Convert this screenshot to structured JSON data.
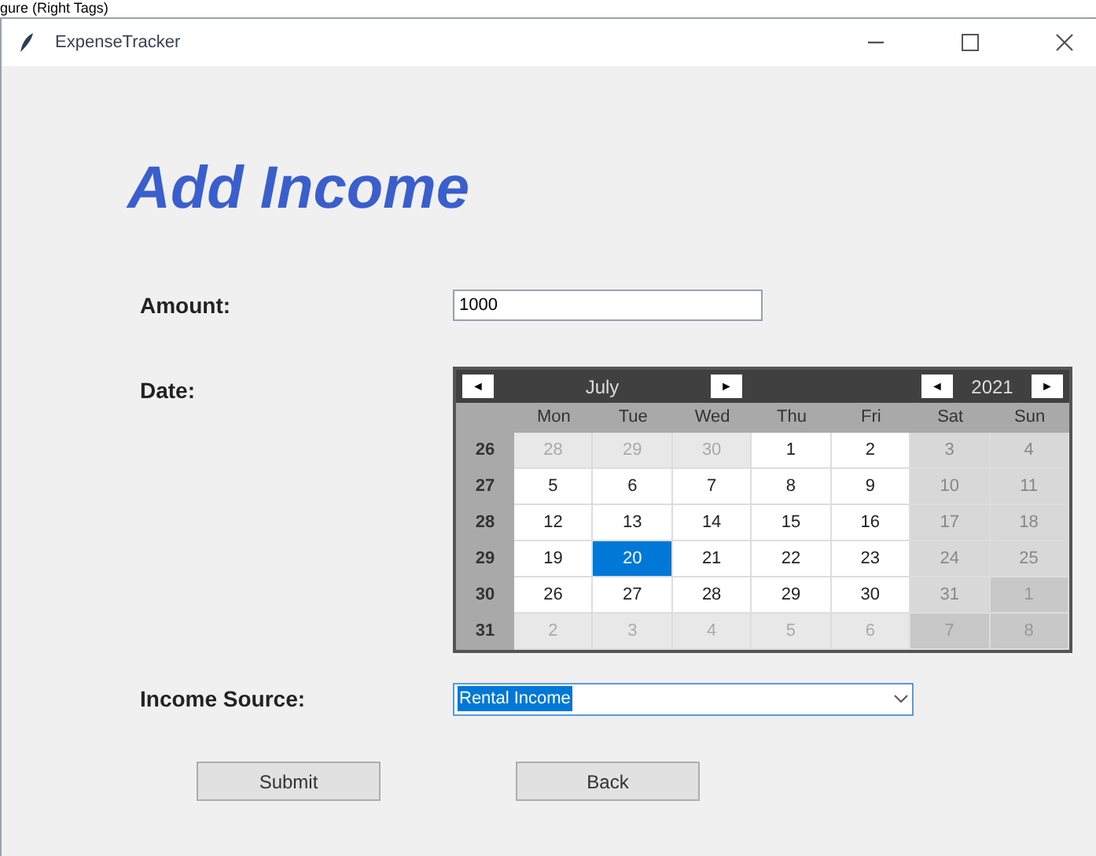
{
  "page_fragment": "gure (Right Tags)",
  "window": {
    "title": "ExpenseTracker"
  },
  "heading": "Add Income",
  "amount": {
    "label": "Amount:",
    "value": "1000"
  },
  "date": {
    "label": "Date:",
    "calendar": {
      "prev_month": "◄",
      "month": "July",
      "next_month": "►",
      "prev_year": "◄",
      "year": "2021",
      "next_year": "►",
      "weekdays": [
        "Mon",
        "Tue",
        "Wed",
        "Thu",
        "Fri",
        "Sat",
        "Sun"
      ],
      "weeks": [
        {
          "number": "26",
          "days": [
            {
              "day": "28",
              "other_month": true,
              "selected": false
            },
            {
              "day": "29",
              "other_month": true,
              "selected": false
            },
            {
              "day": "30",
              "other_month": true,
              "selected": false
            },
            {
              "day": "1",
              "other_month": false,
              "selected": false
            },
            {
              "day": "2",
              "other_month": false,
              "selected": false
            },
            {
              "day": "3",
              "other_month": false,
              "selected": false
            },
            {
              "day": "4",
              "other_month": false,
              "selected": false
            }
          ]
        },
        {
          "number": "27",
          "days": [
            {
              "day": "5",
              "other_month": false,
              "selected": false
            },
            {
              "day": "6",
              "other_month": false,
              "selected": false
            },
            {
              "day": "7",
              "other_month": false,
              "selected": false
            },
            {
              "day": "8",
              "other_month": false,
              "selected": false
            },
            {
              "day": "9",
              "other_month": false,
              "selected": false
            },
            {
              "day": "10",
              "other_month": false,
              "selected": false
            },
            {
              "day": "11",
              "other_month": false,
              "selected": false
            }
          ]
        },
        {
          "number": "28",
          "days": [
            {
              "day": "12",
              "other_month": false,
              "selected": false
            },
            {
              "day": "13",
              "other_month": false,
              "selected": false
            },
            {
              "day": "14",
              "other_month": false,
              "selected": false
            },
            {
              "day": "15",
              "other_month": false,
              "selected": false
            },
            {
              "day": "16",
              "other_month": false,
              "selected": false
            },
            {
              "day": "17",
              "other_month": false,
              "selected": false
            },
            {
              "day": "18",
              "other_month": false,
              "selected": false
            }
          ]
        },
        {
          "number": "29",
          "days": [
            {
              "day": "19",
              "other_month": false,
              "selected": false
            },
            {
              "day": "20",
              "other_month": false,
              "selected": true
            },
            {
              "day": "21",
              "other_month": false,
              "selected": false
            },
            {
              "day": "22",
              "other_month": false,
              "selected": false
            },
            {
              "day": "23",
              "other_month": false,
              "selected": false
            },
            {
              "day": "24",
              "other_month": false,
              "selected": false
            },
            {
              "day": "25",
              "other_month": false,
              "selected": false
            }
          ]
        },
        {
          "number": "30",
          "days": [
            {
              "day": "26",
              "other_month": false,
              "selected": false
            },
            {
              "day": "27",
              "other_month": false,
              "selected": false
            },
            {
              "day": "28",
              "other_month": false,
              "selected": false
            },
            {
              "day": "29",
              "other_month": false,
              "selected": false
            },
            {
              "day": "30",
              "other_month": false,
              "selected": false
            },
            {
              "day": "31",
              "other_month": false,
              "selected": false
            },
            {
              "day": "1",
              "other_month": true,
              "selected": false
            }
          ]
        },
        {
          "number": "31",
          "days": [
            {
              "day": "2",
              "other_month": true,
              "selected": false
            },
            {
              "day": "3",
              "other_month": true,
              "selected": false
            },
            {
              "day": "4",
              "other_month": true,
              "selected": false
            },
            {
              "day": "5",
              "other_month": true,
              "selected": false
            },
            {
              "day": "6",
              "other_month": true,
              "selected": false
            },
            {
              "day": "7",
              "other_month": true,
              "selected": false
            },
            {
              "day": "8",
              "other_month": true,
              "selected": false
            }
          ]
        }
      ]
    }
  },
  "income_source": {
    "label": "Income Source:",
    "value": "Rental Income"
  },
  "buttons": [
    "Submit",
    "Back"
  ]
}
